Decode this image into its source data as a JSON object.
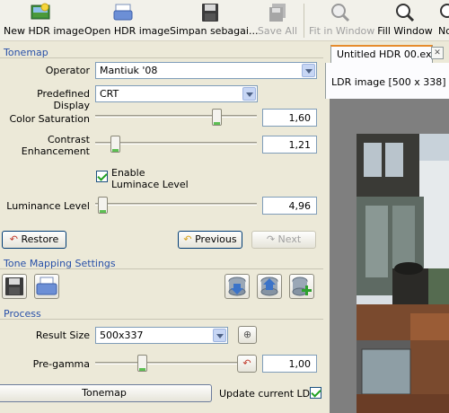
{
  "toolbar": {
    "new_hdr": "New HDR image",
    "open_hdr": "Open HDR image",
    "save_as": "Simpan sebagai...",
    "save_all": "Save All",
    "fit_window": "Fit in Window",
    "fill_window": "Fill Window",
    "next_partial": "No"
  },
  "tonemap": {
    "group_title": "Tonemap",
    "operator_label": "Operator",
    "operator_value": "Mantiuk '08",
    "predef_label": "Predefined Display",
    "predef_value": "CRT",
    "color_sat_label": "Color Saturation",
    "color_sat_value": "1,60",
    "color_sat_level": 0.77,
    "contrast_label_1": "Contrast",
    "contrast_label_2": "Enhancement",
    "contrast_value": "1,21",
    "contrast_level": 0.1,
    "enable_lum_1": "Enable",
    "enable_lum_2": "Luminace Level",
    "enable_lum_checked": true,
    "lum_label": "Luminance Level",
    "lum_value": "4,96",
    "lum_level": 0.02,
    "restore": "Restore",
    "previous": "Previous",
    "next": "Next"
  },
  "settings": {
    "group_title": "Tone Mapping Settings"
  },
  "process": {
    "group_title": "Process",
    "result_size_label": "Result Size",
    "result_size_value": "500x337",
    "pregamma_label": "Pre-gamma",
    "pregamma_value": "1,00",
    "pregamma_level": 0.28,
    "tonemap_button": "Tonemap",
    "update_ldr_label": "Update current LDR",
    "update_ldr_checked": true
  },
  "viewer": {
    "tab_title": "Untitled HDR 00.exr",
    "ldr_info": "LDR image [500 x 338]"
  }
}
